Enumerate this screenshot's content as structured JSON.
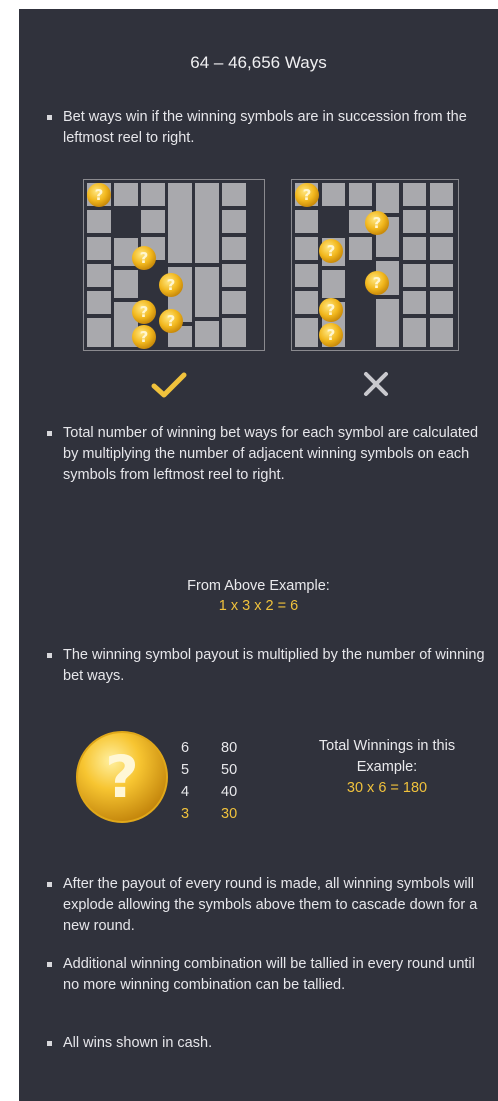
{
  "title": "64 – 46,656 Ways",
  "rules": {
    "r1": "Bet ways win if the winning symbols are in succession from the leftmost reel to right.",
    "r2": "Total number of winning bet ways for each symbol are calculated by multiplying the number of adjacent winning symbols on each symbols from leftmost reel to right.",
    "r3": "The winning symbol payout is multiplied by the number of winning bet ways.",
    "r4": "After the payout of every round is made, all winning symbols will explode allowing the symbols above them to cascade down for a new round.",
    "r5": "Additional winning combination will be tallied in every round until no more winning combination can be tallied.",
    "r6": "All wins shown in cash."
  },
  "example": {
    "heading": "From Above Example:",
    "formula": "1 x 3 x 2 = 6"
  },
  "paytable": {
    "rows": [
      {
        "count": "6",
        "value": "80"
      },
      {
        "count": "5",
        "value": "50"
      },
      {
        "count": "4",
        "value": "40"
      },
      {
        "count": "3",
        "value": "30"
      }
    ]
  },
  "total": {
    "line1": "Total Winnings in this",
    "line2": "Example:",
    "formula": "30 x 6 = 180"
  },
  "icons": {
    "valid": "checkmark-icon",
    "invalid": "cross-icon",
    "symbol": "question-coin-icon"
  },
  "colors": {
    "panel": "#30323c",
    "gold": "#f0c23c",
    "cell": "#a9a9ad"
  }
}
